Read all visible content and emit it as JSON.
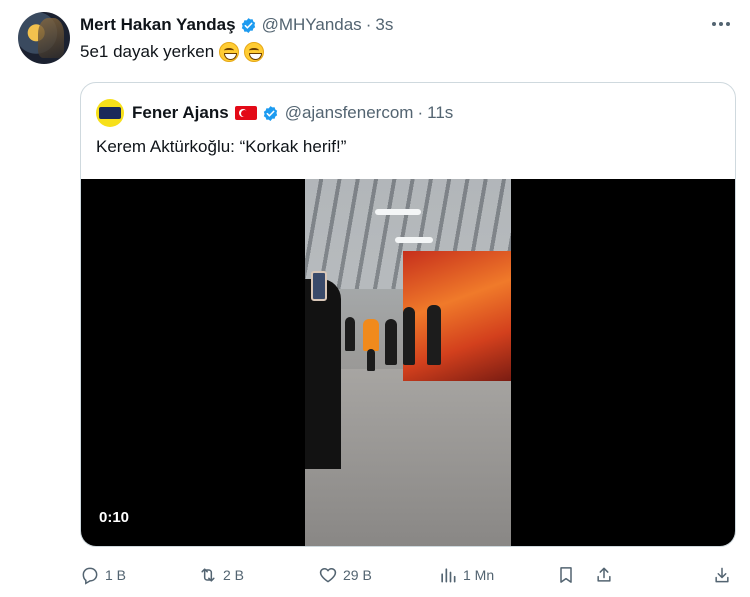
{
  "author": {
    "display_name": "Mert Hakan Yandaş",
    "handle": "@MHYandas",
    "separator": "·",
    "time": "3s",
    "avatar_icon": "profile-photo",
    "verified_icon": "verified-badge-icon"
  },
  "tweet": {
    "text": "5e1 dayak yerken",
    "emojis": [
      "grinning-face-emoji",
      "grinning-face-emoji"
    ]
  },
  "quoted": {
    "display_name": "Fener Ajans",
    "handle": "@ajansfenercom",
    "separator": "·",
    "time": "11s",
    "text": "Kerem Aktürkoğlu: “Korkak herif!”",
    "video": {
      "duration": "0:10"
    }
  },
  "actions": {
    "reply_count": "1 B",
    "retweet_count": "2 B",
    "like_count": "29 B",
    "view_count": "1 Mn"
  },
  "colors": {
    "verified_blue": "#1d9bf0",
    "secondary_text": "#536471",
    "border": "#cfd9de"
  }
}
